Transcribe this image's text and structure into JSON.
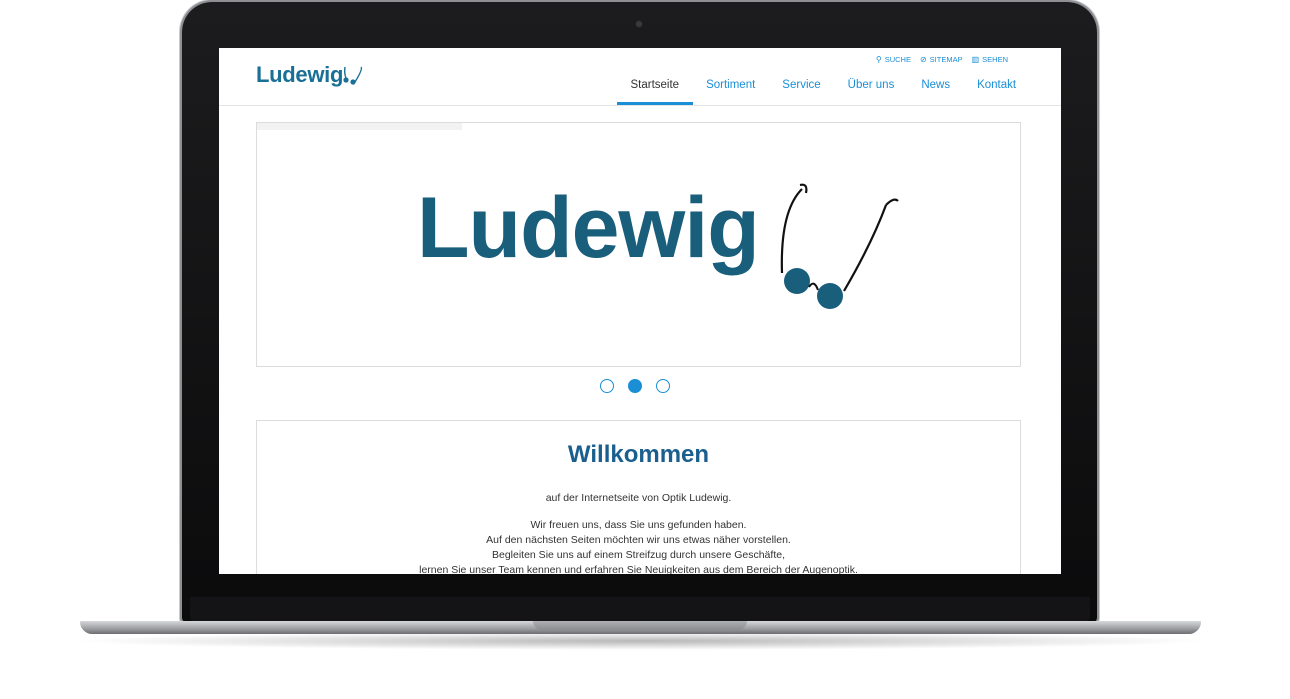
{
  "header": {
    "logo_text": "Ludewig",
    "utility": [
      {
        "label": "SUCHE",
        "icon": "search-icon"
      },
      {
        "label": "SITEMAP",
        "icon": "sitemap-icon"
      },
      {
        "label": "SEHEN",
        "icon": "accessibility-icon"
      }
    ],
    "nav": [
      {
        "label": "Startseite",
        "active": true
      },
      {
        "label": "Sortiment"
      },
      {
        "label": "Service"
      },
      {
        "label": "Über uns"
      },
      {
        "label": "News"
      },
      {
        "label": "Kontakt"
      }
    ]
  },
  "slider": {
    "logo_text": "Ludewig",
    "slide_count": 3,
    "active_slide": 2
  },
  "welcome": {
    "title": "Willkommen",
    "intro": "auf der Internetseite von Optik Ludewig.",
    "lines": [
      "Wir freuen uns, dass Sie uns gefunden haben.",
      "Auf den nächsten Seiten möchten wir uns etwas näher vorstellen.",
      "Begleiten Sie uns auf einem Streifzug durch unsere Geschäfte,",
      "lernen Sie unser Team kennen und erfahren Sie Neuigkeiten aus dem Bereich der Augenoptik."
    ]
  },
  "colors": {
    "brand": "#195e7b",
    "link": "#1a8fd6",
    "heading": "#1a5f8e"
  }
}
